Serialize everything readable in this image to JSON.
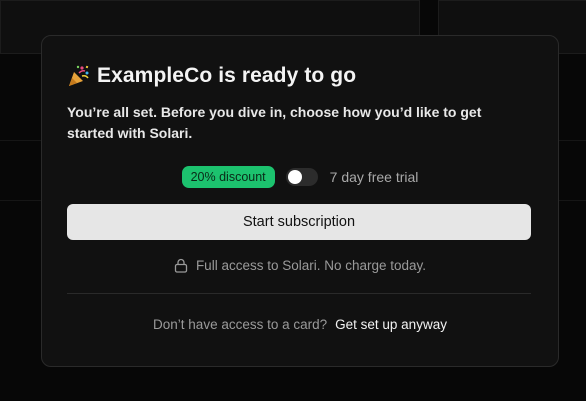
{
  "modal": {
    "title": "ExampleCo is ready to go",
    "title_icon": "party-popper-icon",
    "subtitle": "You’re all set. Before you dive in, choose how you’d like to get started with Solari.",
    "discount_badge": "20% discount",
    "trial_toggle": {
      "label": "7 day free trial",
      "enabled": false
    },
    "primary_button": "Start subscription",
    "access_note": "Full access to Solari. No charge today.",
    "access_icon": "lock-icon",
    "footer_text": "Don’t have access to a card?",
    "footer_link": "Get set up anyway"
  },
  "colors": {
    "badge": "#1cc26e",
    "button": "#e6e6e6",
    "modal_bg": "#111111",
    "page_bg": "#070707"
  }
}
